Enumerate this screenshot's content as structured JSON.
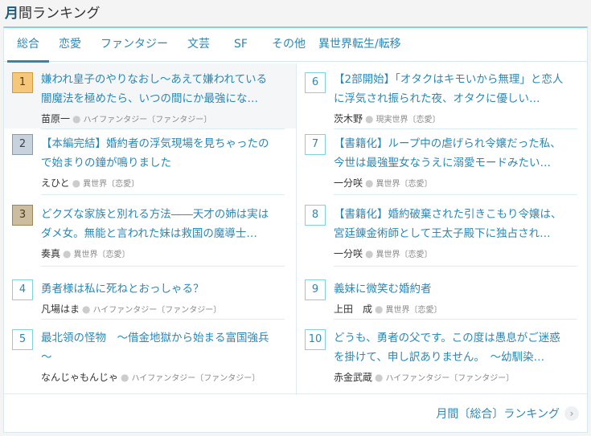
{
  "header": {
    "title_strong": "月",
    "title_rest": "間ランキング"
  },
  "tabs": [
    "総合",
    "恋愛",
    "ファンタジー",
    "文芸",
    "SF",
    "その他",
    "異世界転生/転移"
  ],
  "ranking": [
    {
      "rank": "1",
      "title_line1": "嫌われ皇子のやりなおし〜あえて嫌われている",
      "title_line2": "闇魔法を極めたら、いつの間にか最強にな…",
      "author": "苗原一",
      "genre": "ハイファンタジー〔ファンタジー〕"
    },
    {
      "rank": "2",
      "title_line1": "【本編完結】婚約者の浮気現場を見ちゃったの",
      "title_line2": "で始まりの鐘が鳴りました",
      "author": "えひと",
      "genre": "異世界〔恋愛〕"
    },
    {
      "rank": "3",
      "title_line1": "どクズな家族と別れる方法――天才の姉は実は",
      "title_line2": "ダメ女。無能と言われた妹は救国の魔導士…",
      "author": "奏真",
      "genre": "異世界〔恋愛〕"
    },
    {
      "rank": "4",
      "title_line1": "勇者様は私に死ねとおっしゃる？",
      "title_line2": "",
      "author": "凡場はま",
      "genre": "ハイファンタジー〔ファンタジー〕"
    },
    {
      "rank": "5",
      "title_line1": "最北領の怪物　〜借金地獄から始まる富国強兵",
      "title_line2": "〜",
      "author": "なんじゃもんじゃ",
      "genre": "ハイファンタジー〔ファンタジー〕"
    },
    {
      "rank": "6",
      "title_line1": "【2部開始】「オタクはキモいから無理」と恋人",
      "title_line2": "に浮気され振られた夜、オタクに優しい…",
      "author": "茨木野",
      "genre": "現実世界〔恋愛〕"
    },
    {
      "rank": "7",
      "title_line1": "【書籍化】ループ中の虐げられ令嬢だった私、",
      "title_line2": "今世は最強聖女なうえに溺愛モードみたい…",
      "author": "一分咲",
      "genre": "異世界〔恋愛〕"
    },
    {
      "rank": "8",
      "title_line1": "【書籍化】婚約破棄された引きこもり令嬢は、",
      "title_line2": "宮廷錬金術師として王太子殿下に独占され…",
      "author": "一分咲",
      "genre": "異世界〔恋愛〕"
    },
    {
      "rank": "9",
      "title_line1": "義妹に微笑む婚約者",
      "title_line2": "",
      "author": "上田　成",
      "genre": "異世界〔恋愛〕"
    },
    {
      "rank": "10",
      "title_line1": "どうも、勇者の父です。この度は愚息がご迷惑",
      "title_line2": "を掛けて、申し訳ありません。　〜幼馴染…",
      "author": "赤金武蔵",
      "genre": "ハイファンタジー〔ファンタジー〕"
    }
  ],
  "footer": {
    "link_label": "月間〔総合〕ランキング"
  }
}
